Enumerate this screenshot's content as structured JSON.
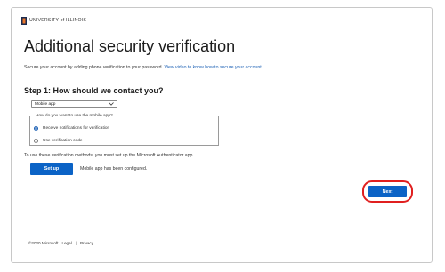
{
  "header": {
    "logo_text": "UNIVERSITY of ILLINOIS",
    "title": "Additional security verification"
  },
  "intro": {
    "text": "Secure your account by adding phone verification to your password.",
    "link": "View video to know how to secure your account"
  },
  "step1": {
    "title": "Step 1: How should we contact you?",
    "method_select_value": "Mobile app",
    "mobile_group_legend": "How do you want to use the mobile app?",
    "options": [
      {
        "label": "Receive notifications for verification",
        "checked": true
      },
      {
        "label": "Use verification code",
        "checked": false
      }
    ],
    "setup_note": "To use these verification methods, you must set up the Microsoft Authenticator app.",
    "setup_label": "Set up",
    "config_status": "Mobile app has been configured."
  },
  "actions": {
    "next_label": "Next",
    "highlight_color": "#e01f1f"
  },
  "footer": {
    "copyright": "©2020 Microsoft",
    "legal": "Legal",
    "privacy": "Privacy"
  },
  "colors": {
    "accent": "#0b63c6",
    "link": "#1a5fb4"
  }
}
